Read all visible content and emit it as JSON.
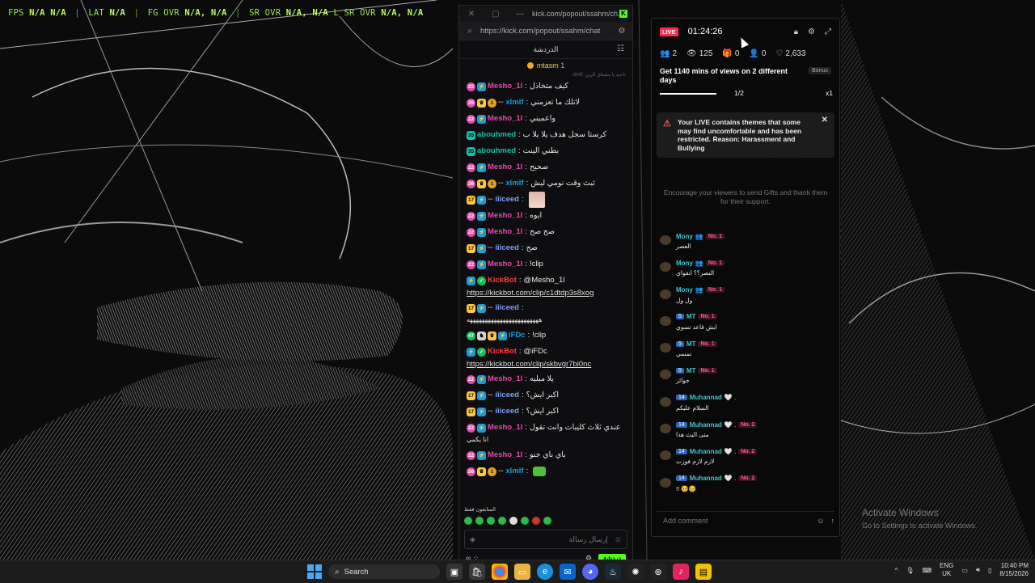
{
  "overlay": {
    "fps_label": "FPS",
    "fps_val": "N/A N/A",
    "lat_label": "LAT",
    "lat_val": "N/A",
    "fg_label": "FG OVR",
    "fg_val": "N/A, N/A",
    "sr_label": "SR OVR",
    "sr_val": "N/A, N/A",
    "lsr_label": "L SR OVR",
    "lsr_val": "N/A, N/A"
  },
  "chat_window": {
    "title": "kick.com/popout/ssahm/ch...",
    "url": "https://kick.com/popout/ssahm/chat",
    "header": "الدردشة",
    "pinned_user": "mtasm",
    "pinned_count": "1",
    "faded_line": "xlmlf: ناعيه يا مشتاق الزين",
    "messages": [
      {
        "badges": [
          {
            "t": "22",
            "c": "pink"
          },
          {
            "t": "⚡",
            "c": "sky"
          }
        ],
        "user": "Mesho_1l",
        "color": "#e34ba9",
        "text": "كيف متخاذل"
      },
      {
        "badges": [
          {
            "t": "26",
            "c": "pink"
          },
          {
            "t": "♛",
            "c": "yel"
          },
          {
            "t": "1",
            "c": "gold"
          }
        ],
        "sub": "▪▪▪",
        "user": "xlmlf",
        "color": "#1d9bd8",
        "text": "لاتلك ما تعزمني"
      },
      {
        "badges": [
          {
            "t": "22",
            "c": "pink"
          },
          {
            "t": "⚡",
            "c": "sky"
          }
        ],
        "user": "Mesho_1l",
        "color": "#e34ba9",
        "text": "واعميني"
      },
      {
        "badges": [
          {
            "t": "35",
            "c": "teal"
          }
        ],
        "user": "abouhmed",
        "color": "#13c2a5",
        "text": "كرستا سجل هدف يلا يلا ب"
      },
      {
        "badges": [
          {
            "t": "35",
            "c": "teal"
          }
        ],
        "user": "abouhmed",
        "color": "#13c2a5",
        "text": "بطني الينت"
      },
      {
        "badges": [
          {
            "t": "22",
            "c": "pink"
          },
          {
            "t": "⚡",
            "c": "sky"
          }
        ],
        "user": "Mesho_1l",
        "color": "#e34ba9",
        "text": "صحيح"
      },
      {
        "badges": [
          {
            "t": "26",
            "c": "pink"
          },
          {
            "t": "♛",
            "c": "yel"
          },
          {
            "t": "1",
            "c": "gold"
          }
        ],
        "sub": "▪▪▪",
        "user": "xlmlf",
        "color": "#1d9bd8",
        "text": "ثبث وقت نومي ليش"
      },
      {
        "badges": [
          {
            "t": "17",
            "c": "yel"
          },
          {
            "t": "⚡",
            "c": "sky"
          }
        ],
        "sub": "▪▪▪",
        "user": "iiiceed",
        "color": "#7f9cf5",
        "text": "",
        "emote": true
      },
      {
        "badges": [
          {
            "t": "22",
            "c": "pink"
          },
          {
            "t": "⚡",
            "c": "sky"
          }
        ],
        "user": "Mesho_1l",
        "color": "#e34ba9",
        "text": "ايوه"
      },
      {
        "badges": [
          {
            "t": "22",
            "c": "pink"
          },
          {
            "t": "⚡",
            "c": "sky"
          }
        ],
        "user": "Mesho_1l",
        "color": "#e34ba9",
        "text": "صح صح"
      },
      {
        "badges": [
          {
            "t": "17",
            "c": "yel"
          },
          {
            "t": "⚡",
            "c": "sky"
          }
        ],
        "sub": "▪▪▪",
        "user": "iiiceed",
        "color": "#7f9cf5",
        "text": "صح"
      },
      {
        "badges": [
          {
            "t": "22",
            "c": "pink"
          },
          {
            "t": "⚡",
            "c": "sky"
          }
        ],
        "user": "Mesho_1l",
        "color": "#e34ba9",
        "text": "!clip"
      },
      {
        "badges": [
          {
            "t": "⚡",
            "c": "sky"
          },
          {
            "t": "✓",
            "c": "grn"
          }
        ],
        "user": "KickBot",
        "color": "#ff3b3b",
        "text": "@Mesho_1l",
        "link": "https://kickbot.com/clip/c1dtdp3s8xog"
      },
      {
        "badges": [
          {
            "t": "17",
            "c": "yel"
          },
          {
            "t": "⚡",
            "c": "sky"
          }
        ],
        "sub": "▪▪▪",
        "user": "iiiceed",
        "color": "#7f9cf5",
        "text": "",
        "extra": "ههههههههههههههههههههههههه"
      },
      {
        "badges": [
          {
            "t": "47",
            "c": "grn"
          },
          {
            "t": "♞",
            "c": "wh"
          },
          {
            "t": "♛",
            "c": "yel"
          },
          {
            "t": "⚡",
            "c": "sky"
          }
        ],
        "user": "iFDc",
        "color": "#1d9bd8",
        "text": "!clip"
      },
      {
        "badges": [
          {
            "t": "⚡",
            "c": "sky"
          },
          {
            "t": "✓",
            "c": "grn"
          }
        ],
        "user": "KickBot",
        "color": "#ff3b3b",
        "text": "@iFDc",
        "link": "https://kickbot.com/clip/skbvgr7bi0nc"
      },
      {
        "badges": [
          {
            "t": "22",
            "c": "pink"
          },
          {
            "t": "⚡",
            "c": "sky"
          }
        ],
        "user": "Mesho_1l",
        "color": "#e34ba9",
        "text": "يلا مبليه"
      },
      {
        "badges": [
          {
            "t": "17",
            "c": "yel"
          },
          {
            "t": "⚡",
            "c": "sky"
          }
        ],
        "sub": "▪▪▪",
        "user": "iiiceed",
        "color": "#7f9cf5",
        "text": "اكبر ايش؟"
      },
      {
        "badges": [
          {
            "t": "17",
            "c": "yel"
          },
          {
            "t": "⚡",
            "c": "sky"
          }
        ],
        "sub": "▪▪▪",
        "user": "iiiceed",
        "color": "#7f9cf5",
        "text": "اكبر ايش؟"
      },
      {
        "badges": [
          {
            "t": "22",
            "c": "pink"
          },
          {
            "t": "⚡",
            "c": "sky"
          }
        ],
        "user": "Mesho_1l",
        "color": "#e34ba9",
        "text": "عندي ثلاث كليبات وانت تقول",
        "extra": "انا يكمي"
      },
      {
        "badges": [
          {
            "t": "22",
            "c": "pink"
          },
          {
            "t": "⚡",
            "c": "sky"
          }
        ],
        "user": "Mesho_1l",
        "color": "#e34ba9",
        "text": "باي باي جنو"
      },
      {
        "badges": [
          {
            "t": "26",
            "c": "pink"
          },
          {
            "t": "♛",
            "c": "yel"
          },
          {
            "t": "1",
            "c": "gold"
          }
        ],
        "sub": "▪▪▪",
        "user": "xlmlf",
        "color": "#1d9bd8",
        "text": "",
        "emote2": true
      }
    ],
    "followers_label": "المتابعون فقط",
    "input_placeholder": "إرسال رسالة",
    "send_label": "دردشة"
  },
  "live_panel": {
    "live_badge": "LIVE",
    "timer": "01:24:26",
    "stats": [
      {
        "icon": "users-icon",
        "glyph": "👥",
        "value": "2"
      },
      {
        "icon": "eye-icon",
        "glyph": "👁",
        "value": "125"
      },
      {
        "icon": "gift-icon",
        "glyph": "🎁",
        "value": "0"
      },
      {
        "icon": "follow-icon",
        "glyph": "👤",
        "value": "0"
      },
      {
        "icon": "heart-icon",
        "glyph": "♡",
        "value": "2,633"
      }
    ],
    "goal_text": "Get 1140 mins of views on 2 different days",
    "goal_bonus": "Bonus",
    "goal_progress": "1/2",
    "goal_progress_fraction": 0.5,
    "goal_multiplier": "x1",
    "warning": "Your LIVE contains themes that some may find uncomfortable and has been restricted. Reason: Harassment and Bullying",
    "gifts_hint": "Encourage your viewers to send Gifts and thank them for their support.",
    "comments": [
      {
        "name": "Mony",
        "lvl": "",
        "rank": "No. 1",
        "extra": "👥",
        "text": "العصر"
      },
      {
        "name": "Mony",
        "lvl": "",
        "rank": "No. 1",
        "extra": "👥",
        "text": "النصر؟؟ انقواي"
      },
      {
        "name": "Mony",
        "lvl": "",
        "rank": "No. 1",
        "extra": "👥",
        "text": "ول ول"
      },
      {
        "name": "MT",
        "lvl": "5",
        "rank": "No. 1",
        "extra": "",
        "text": "ايش قاعد تسوي"
      },
      {
        "name": "MT",
        "lvl": "5",
        "rank": "No. 1",
        "extra": "",
        "text": "تمنمي"
      },
      {
        "name": "MT",
        "lvl": "5",
        "rank": "No. 1",
        "extra": "",
        "text": "جوائز"
      },
      {
        "name": "Muhannad",
        "lvl": "14",
        "rank": "",
        "extra": "🤍 .",
        "text": "السلام عليكم"
      },
      {
        "name": "Muhannad",
        "lvl": "14",
        "rank": "No. 2",
        "extra": "🤍 .",
        "text": "متى البث هذا"
      },
      {
        "name": "Muhannad",
        "lvl": "14",
        "rank": "No. 2",
        "extra": "🤍 .",
        "text": "لازم لازم فوزت"
      },
      {
        "name": "Muhannad",
        "lvl": "14",
        "rank": "No. 2",
        "extra": "🤍 .",
        "text": "!! 🥺🥺"
      }
    ],
    "add_comment": "Add comment"
  },
  "watermark": {
    "line1": "Activate Windows",
    "line2": "Go to Settings to activate Windows."
  },
  "taskbar": {
    "search_label": "Search",
    "lang_line1": "ENG",
    "lang_line2": "UK",
    "time": "10:40 PM",
    "date": "8/15/2026"
  }
}
